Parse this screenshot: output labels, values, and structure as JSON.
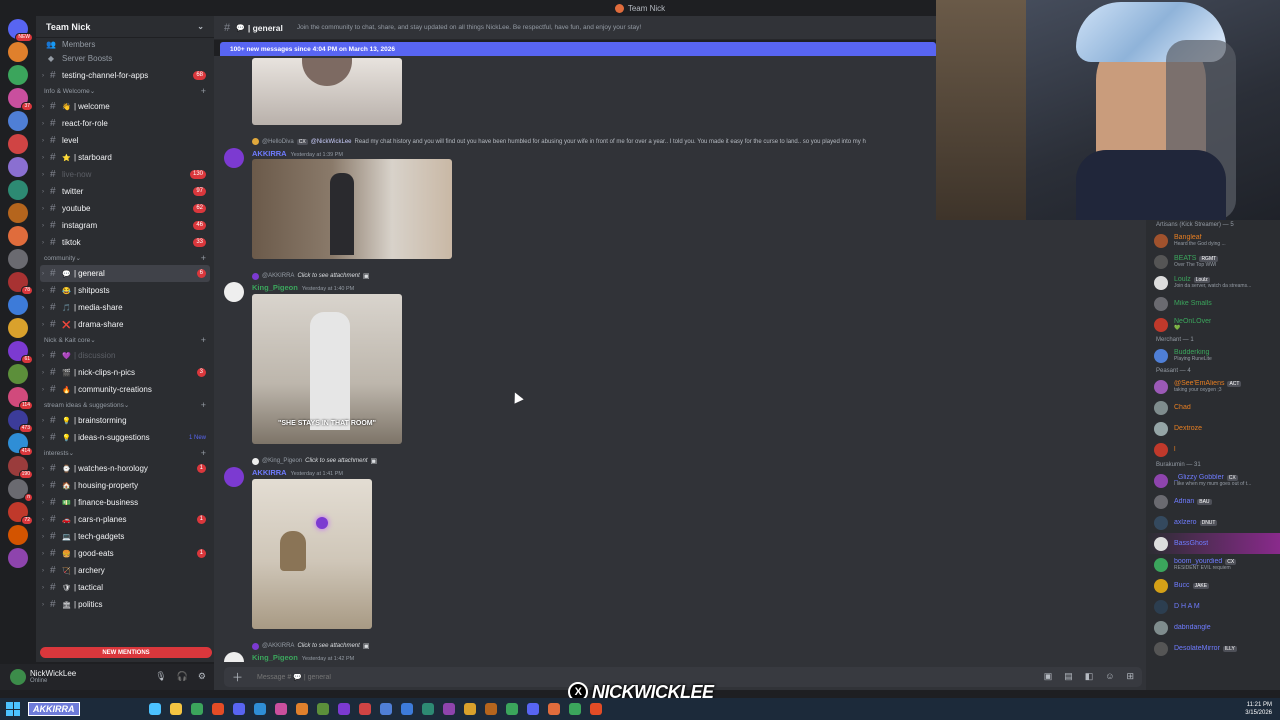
{
  "window": {
    "title": "Team Nick"
  },
  "server": {
    "name": "Team Nick",
    "items": [
      "Members",
      "Server Boosts"
    ],
    "rail": [
      {
        "color": "#5865f2",
        "badge": "NEW"
      },
      {
        "color": "#e0802c",
        "badge": ""
      },
      {
        "color": "#3ba55c",
        "badge": ""
      },
      {
        "color": "#c94f9e",
        "badge": "37"
      },
      {
        "color": "#4f7fd6",
        "badge": ""
      },
      {
        "color": "#d04444",
        "badge": ""
      },
      {
        "color": "#8a6fd1",
        "badge": ""
      },
      {
        "color": "#2d8a73",
        "badge": ""
      },
      {
        "color": "#b5651d",
        "badge": ""
      },
      {
        "color": "#e06c3c",
        "badge": ""
      },
      {
        "color": "#6a6a70",
        "badge": ""
      },
      {
        "color": "#a83232",
        "badge": "78"
      },
      {
        "color": "#3d7bd9",
        "badge": ""
      },
      {
        "color": "#d9a12c",
        "badge": ""
      },
      {
        "color": "#7c3ad1",
        "badge": "61"
      },
      {
        "color": "#5c8f3a",
        "badge": ""
      },
      {
        "color": "#d14a7c",
        "badge": "114"
      },
      {
        "color": "#3c3c9a",
        "badge": "473"
      },
      {
        "color": "#2f8ed6",
        "badge": "414"
      },
      {
        "color": "#9a3c3c",
        "badge": "190"
      },
      {
        "color": "#6a6a70",
        "badge": "n"
      },
      {
        "color": "#c0392b",
        "badge": "72"
      },
      {
        "color": "#d35400",
        "badge": ""
      },
      {
        "color": "#8e44ad",
        "badge": ""
      }
    ]
  },
  "sidebar": {
    "top_channels": [
      {
        "name": "testing-channel-for-apps",
        "emoji": "",
        "badge": "68",
        "state": "unread"
      }
    ],
    "categories": [
      {
        "name": "Info & Welcome",
        "channels": [
          {
            "name": "welcome",
            "emoji": "👋",
            "badge": "",
            "state": "unread"
          },
          {
            "name": "react-for-role",
            "emoji": "",
            "badge": "",
            "state": "unread"
          },
          {
            "name": "level",
            "emoji": "",
            "badge": "",
            "state": "unread"
          },
          {
            "name": "starboard",
            "emoji": "⭐",
            "badge": "",
            "state": "unread"
          },
          {
            "name": "live-now",
            "emoji": "",
            "badge": "130",
            "state": "muted"
          },
          {
            "name": "twitter",
            "emoji": "",
            "badge": "97",
            "state": "unread"
          },
          {
            "name": "youtube",
            "emoji": "",
            "badge": "62",
            "state": "unread"
          },
          {
            "name": "instagram",
            "emoji": "",
            "badge": "46",
            "state": "unread"
          },
          {
            "name": "tiktok",
            "emoji": "",
            "badge": "33",
            "state": "unread"
          }
        ]
      },
      {
        "name": "community",
        "channels": [
          {
            "name": "general",
            "emoji": "💬",
            "badge": "6",
            "state": "active"
          },
          {
            "name": "shitposts",
            "emoji": "😂",
            "badge": "",
            "state": "unread"
          },
          {
            "name": "media-share",
            "emoji": "🎵",
            "badge": "",
            "state": "unread"
          },
          {
            "name": "drama-share",
            "emoji": "❌",
            "badge": "",
            "state": "unread"
          }
        ]
      },
      {
        "name": "Nick & Kait core",
        "channels": [
          {
            "name": "discussion",
            "emoji": "💜",
            "badge": "",
            "state": "muted"
          },
          {
            "name": "nick-clips-n-pics",
            "emoji": "🎬",
            "badge": "3",
            "state": "unread"
          },
          {
            "name": "community-creations",
            "emoji": "🔥",
            "badge": "",
            "state": "unread"
          }
        ]
      },
      {
        "name": "stream ideas & suggestions",
        "channels": [
          {
            "name": "brainstorming",
            "emoji": "💡",
            "badge": "",
            "state": "unread"
          },
          {
            "name": "ideas-n-suggestions",
            "emoji": "💡",
            "badge": "1 New",
            "state": "unread"
          }
        ]
      },
      {
        "name": "interests",
        "channels": [
          {
            "name": "watches-n-horology",
            "emoji": "⌚",
            "badge": "1",
            "state": "unread"
          },
          {
            "name": "housing-property",
            "emoji": "🏠",
            "badge": "",
            "state": "unread"
          },
          {
            "name": "finance-business",
            "emoji": "💵",
            "badge": "",
            "state": "unread"
          },
          {
            "name": "cars-n-planes",
            "emoji": "🚗",
            "badge": "1",
            "state": "unread"
          },
          {
            "name": "tech-gadgets",
            "emoji": "💻",
            "badge": "",
            "state": "unread"
          },
          {
            "name": "good-eats",
            "emoji": "🍔",
            "badge": "1",
            "state": "unread"
          },
          {
            "name": "archery",
            "emoji": "🏹",
            "badge": "",
            "state": "unread"
          },
          {
            "name": "tactical",
            "emoji": "🛡",
            "badge": "",
            "state": "unread"
          },
          {
            "name": "politics",
            "emoji": "🏛",
            "badge": "",
            "state": "unread"
          }
        ]
      }
    ],
    "new_mentions": "NEW MENTIONS"
  },
  "user": {
    "name": "NickWickLee",
    "status": "Online"
  },
  "channel": {
    "name": "general",
    "topic": "Join the community to chat, share, and stay updated on all things NickLee. Be respectful, have fun, and enjoy your stay!",
    "new_banner": "100+ new messages since 4:04 PM on March 13, 2026"
  },
  "messages": [
    {
      "reply_name": "@HelloDiva",
      "reply_tag": "CX",
      "reply_mention": "@NickWickLee",
      "reply_text": "Read my chat history and you will find out you have been humbled for abusing your wife in front of me for over a year.. I told you.  You made it easy for the curse to land.. so you played into my h",
      "author": "AKKIRRA",
      "author_color": "#6f7cff",
      "timestamp": "Yesterday at 1:39 PM"
    },
    {
      "reply_name": "@AKKIRRA",
      "reply_text": "Click to see attachment",
      "author": "King_Pigeon",
      "author_color": "#3ba55c",
      "timestamp": "Yesterday at 1:40 PM",
      "caption": "\"SHE STAYS IN THAT ROOM\""
    },
    {
      "reply_name": "@King_Pigeon",
      "reply_text": "Click to see attachment",
      "author": "AKKIRRA",
      "author_color": "#6f7cff",
      "timestamp": "Yesterday at 1:41 PM"
    },
    {
      "reply_name": "@AKKIRRA",
      "reply_text": "Click to see attachment",
      "author": "King_Pigeon",
      "author_color": "#3ba55c",
      "timestamp": "Yesterday at 1:42 PM"
    }
  ],
  "members": {
    "groups": [
      {
        "title": "Artisans (Kick Streamer) — 5",
        "items": [
          {
            "name": "Bangleaf",
            "color": "#e67e22",
            "tag": "",
            "activity": "Heard the God dying ...",
            "av": "#a0522d"
          },
          {
            "name": "BEATS",
            "color": "#3ba55c",
            "tag": "RGMT",
            "activity": "Over The Top WWI",
            "av": "#555555"
          },
          {
            "name": "Loulz",
            "color": "#3ba55c",
            "tag": "Loulz",
            "activity": "Join da server, watch da streams...",
            "av": "#dddddd"
          },
          {
            "name": "Mike Smalls",
            "color": "#3ba55c",
            "tag": "",
            "activity": "",
            "av": "#6a6a70"
          },
          {
            "name": "NeOnLOver",
            "color": "#3ba55c",
            "tag": "",
            "activity": "💚",
            "av": "#c0392b"
          }
        ]
      },
      {
        "title": "Merchant — 1",
        "items": [
          {
            "name": "Budderking",
            "color": "#3ba55c",
            "tag": "",
            "activity": "Playing RuneLite",
            "av": "#4f7fd6"
          }
        ]
      },
      {
        "title": "Peasant — 4",
        "items": [
          {
            "name": "@See'EmAliens",
            "color": "#e67e22",
            "tag": "ACT",
            "activity": "taking your oxygen ;3",
            "av": "#9b59b6"
          },
          {
            "name": "Chad",
            "color": "#e67e22",
            "tag": "",
            "activity": "",
            "av": "#7f8c8d"
          },
          {
            "name": "Dextroze",
            "color": "#e67e22",
            "tag": "",
            "activity": "",
            "av": "#95a5a6"
          },
          {
            "name": "l",
            "color": "#e67e22",
            "tag": "",
            "activity": "",
            "av": "#c0392b"
          }
        ]
      },
      {
        "title": "Burakumin — 31",
        "items": [
          {
            "name": "_Glizzy Gobbler",
            "color": "#6f7cff",
            "tag": "CX",
            "activity": "I like when my mum goes out of t...",
            "av": "#8e44ad"
          },
          {
            "name": "Adrian",
            "color": "#6f7cff",
            "tag": "BAU",
            "activity": "",
            "av": "#6a6a70"
          },
          {
            "name": "axlzero",
            "color": "#6f7cff",
            "tag": "DNUT",
            "activity": "",
            "av": "#34495e"
          },
          {
            "name": "BassGhost",
            "color": "#6f7cff",
            "tag": "",
            "activity": "",
            "av": "#dddddd",
            "hl": true
          },
          {
            "name": "boom_yourdied",
            "color": "#6f7cff",
            "tag": "CX",
            "activity": "RESIDENT EVIL requiem",
            "av": "#3ba55c"
          },
          {
            "name": "Bucc",
            "color": "#6f7cff",
            "tag": "JAKE",
            "activity": "",
            "av": "#d4a017"
          },
          {
            "name": "D H A M",
            "color": "#6f7cff",
            "tag": "",
            "activity": "",
            "av": "#2c3e50"
          },
          {
            "name": "dabndangle",
            "color": "#6f7cff",
            "tag": "",
            "activity": "",
            "av": "#7f8c8d"
          },
          {
            "name": "DesolateMirror",
            "color": "#6f7cff",
            "tag": "ILLY",
            "activity": "",
            "av": "#555555"
          }
        ]
      }
    ]
  },
  "composer": {
    "placeholder": "Message # 💬 | general"
  },
  "watermark": {
    "symbol": "X",
    "text": "NICKWICKLEE"
  },
  "taskbar": {
    "pinned_label": "AKKIRRA",
    "time": "11:21 PM",
    "date": "3/15/2026"
  }
}
